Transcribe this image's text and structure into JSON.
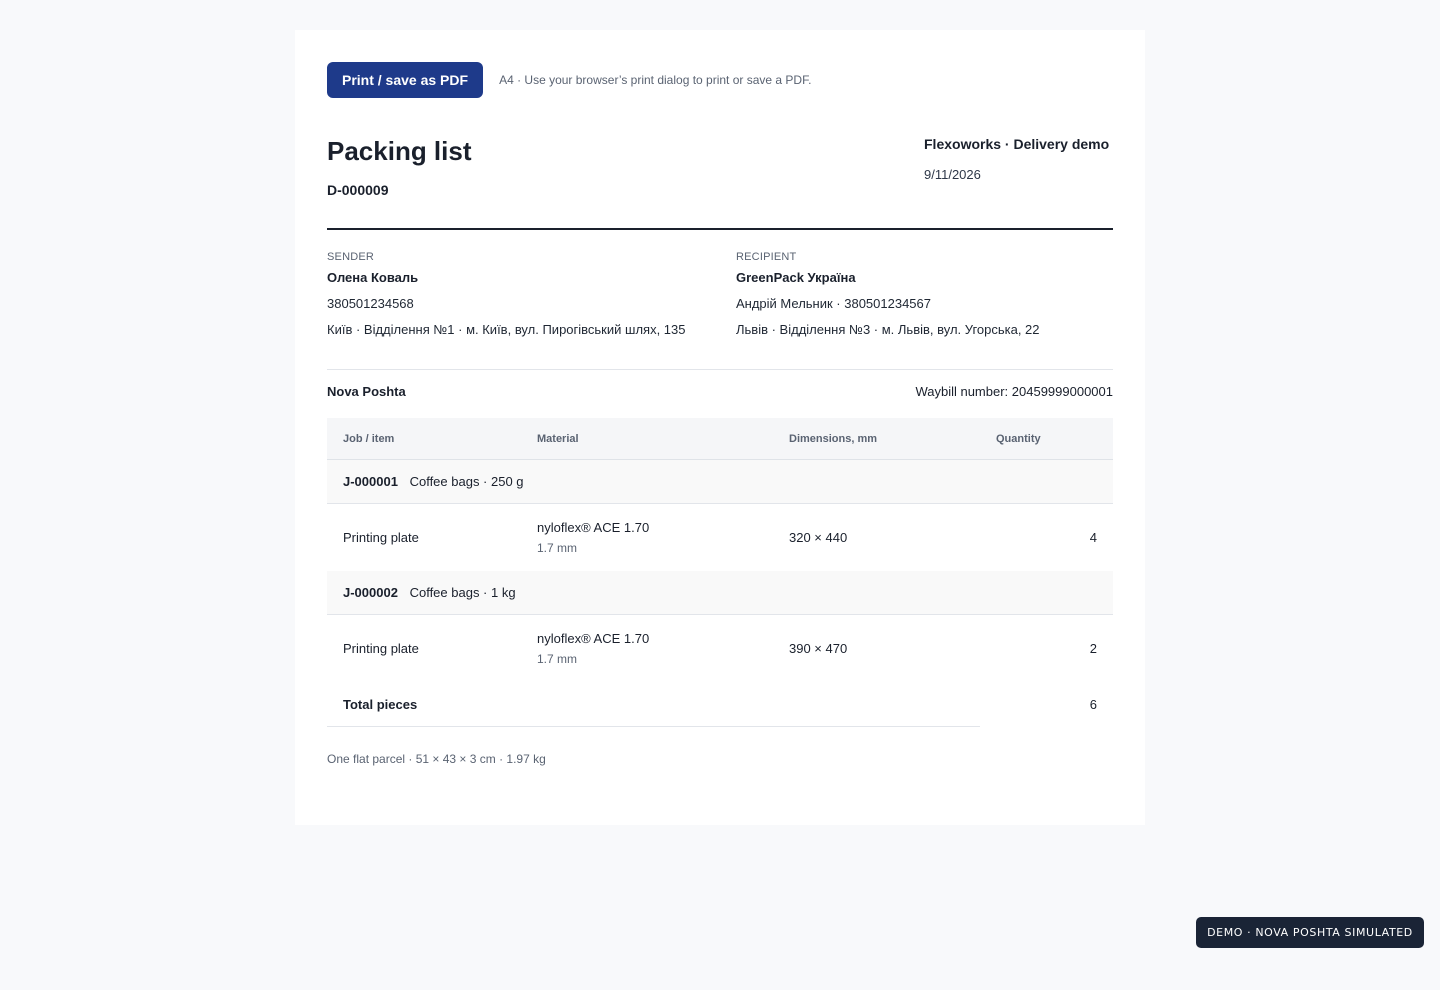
{
  "toolbar": {
    "print_label": "Print / save as PDF",
    "hint": "A4 · Use your browser’s print dialog to print or save a PDF."
  },
  "header": {
    "title": "Packing list",
    "number": "D-000009",
    "company": "Flexoworks · Delivery demo",
    "date": "9/11/2026"
  },
  "sender": {
    "label": "SENDER",
    "name": "Олена Коваль",
    "phone": "380501234568",
    "address": "Київ · Відділення №1 · м. Київ, вул. Пирогівський шлях, 135"
  },
  "recipient": {
    "label": "RECIPIENT",
    "name": "GreenPack Україна",
    "contact": "Андрій Мельник · 380501234567",
    "address": "Львів · Відділення №3 · м. Львів, вул. Угорська, 22"
  },
  "carrier": {
    "name": "Nova Poshta",
    "waybill": "Waybill number: 20459999000001"
  },
  "table": {
    "columns": [
      "Job / item",
      "Material",
      "Dimensions, mm",
      "Quantity"
    ],
    "jobs": [
      {
        "id": "J-000001",
        "desc": "Coffee bags · 250 g",
        "item": {
          "name": "Printing plate",
          "material": "nyloflex® ACE 1.70",
          "thickness": "1.7 mm",
          "dimensions": "320 × 440",
          "quantity": "4"
        }
      },
      {
        "id": "J-000002",
        "desc": "Coffee bags · 1 kg",
        "item": {
          "name": "Printing plate",
          "material": "nyloflex® ACE 1.70",
          "thickness": "1.7 mm",
          "dimensions": "390 × 470",
          "quantity": "2"
        }
      }
    ],
    "total_label": "Total pieces",
    "total_value": "6"
  },
  "parcel_note": "One flat parcel · 51 × 43 × 3 cm · 1.97 kg",
  "demo_badge": "DEMO · NOVA POSHTA SIMULATED",
  "colors": {
    "accent": "#1e3a8a",
    "badge_bg": "#1a2436",
    "page_bg": "#f8f9fb"
  }
}
